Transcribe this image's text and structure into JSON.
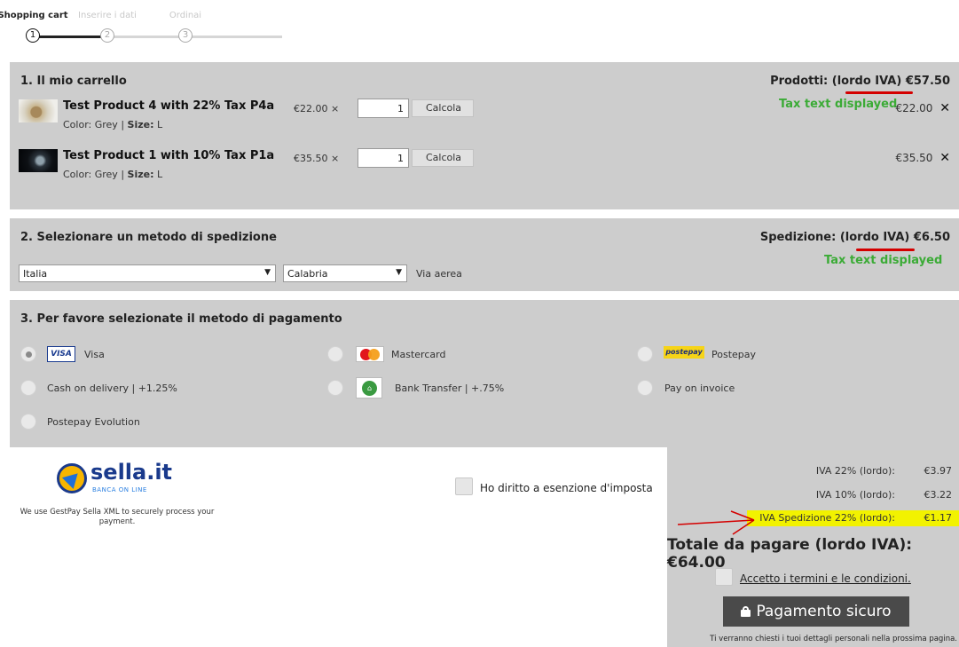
{
  "stepper": {
    "steps": [
      {
        "label": "Shopping cart",
        "number": "1"
      },
      {
        "label": "Inserire i dati",
        "number": "2"
      },
      {
        "label": "Ordinai",
        "number": "3"
      }
    ]
  },
  "cart": {
    "title": "1. Il mio carrello",
    "summary": "Prodotti: (lordo IVA) €57.50",
    "annotation": "Tax text displayed",
    "items": [
      {
        "name": "Test Product 4 with 22% Tax  P4a",
        "color_label": "Color:",
        "color": "Grey",
        "size_label": "Size:",
        "size": "L",
        "unit_price": "€22.00 ×",
        "qty": "1",
        "calc": "Calcola",
        "total": "€22.00",
        "remove_icon": "close-icon"
      },
      {
        "name": "Test Product 1 with 10% Tax  P1a",
        "color_label": "Color:",
        "color": "Grey",
        "size_label": "Size:",
        "size": "L",
        "unit_price": "€35.50 ×",
        "qty": "1",
        "calc": "Calcola",
        "total": "€35.50",
        "remove_icon": "close-icon"
      }
    ]
  },
  "shipping": {
    "title": "2. Selezionare un metodo di spedizione",
    "summary": "Spedizione: (lordo IVA) €6.50",
    "annotation": "Tax text displayed",
    "country": "Italia",
    "region": "Calabria",
    "method": "Via aerea"
  },
  "payment": {
    "title": "3. Per favore selezionate il metodo di pagamento",
    "options": [
      {
        "label": "Visa",
        "logo": "VISA"
      },
      {
        "label": "Mastercard"
      },
      {
        "label": "Postepay",
        "logo": "postepay"
      },
      {
        "label": "Cash on delivery | +1.25%"
      },
      {
        "label": "Bank Transfer | +.75%"
      },
      {
        "label": "Pay on invoice"
      },
      {
        "label": "Postepay Evolution"
      }
    ],
    "selected": "Visa"
  },
  "gateway": {
    "brand": "sella.it",
    "brand_sub": "BANCA ON LINE",
    "note": "We use GestPay Sella XML to securely process your payment."
  },
  "exemption": {
    "label": "Ho diritto a esenzione d'imposta"
  },
  "summary": {
    "lines": [
      {
        "label": "IVA 22% (lordo):",
        "value": "€3.97"
      },
      {
        "label": "IVA 10% (lordo):",
        "value": "€3.22"
      },
      {
        "label": "IVA Spedizione 22% (lordo):",
        "value": "€1.17"
      }
    ],
    "total": "Totale da pagare (lordo IVA):  €64.00",
    "terms": "Accetto i termini e le condizioni.",
    "pay_button": "Pagamento sicuro",
    "footnote": "Ti verranno chiesti i tuoi dettagli personali nella prossima pagina."
  },
  "colors": {
    "panel": "#cdcdcd",
    "annotation_green": "#3bab36",
    "annotation_red": "#d40000",
    "highlight": "#f2f200",
    "pay_button": "#4a4a4a"
  }
}
